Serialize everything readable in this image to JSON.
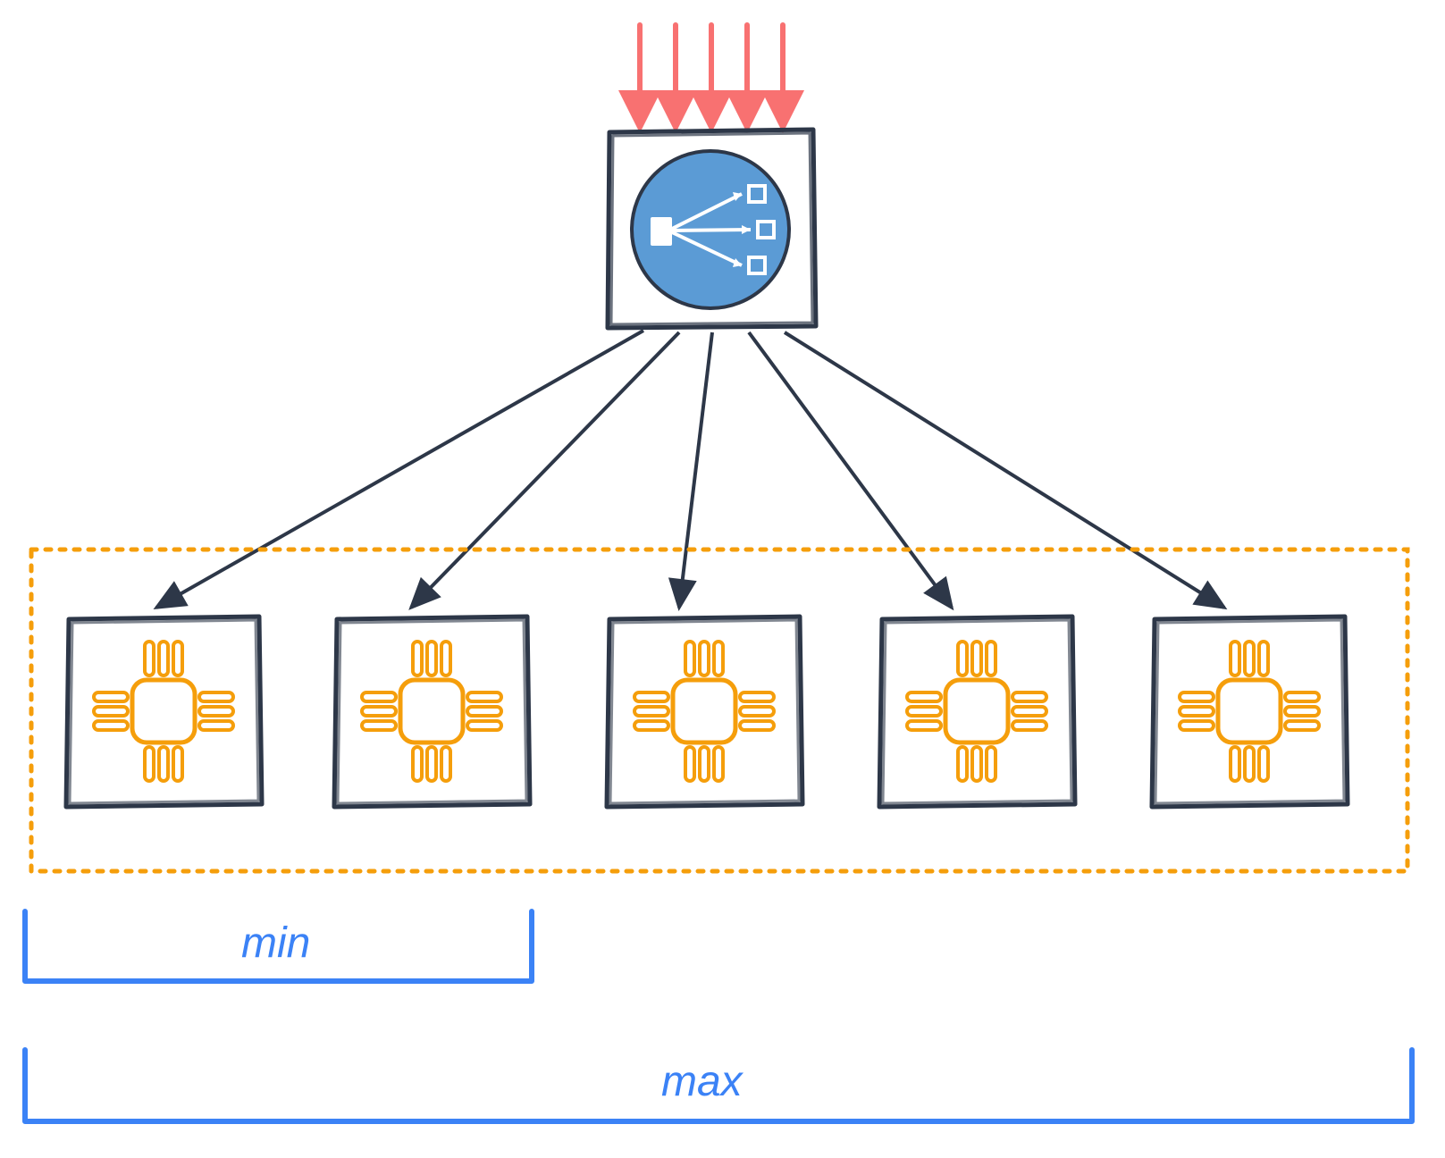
{
  "diagram": {
    "type": "load-balancer-autoscaling",
    "incoming_requests": {
      "count": 5,
      "color": "#F87171"
    },
    "load_balancer": {
      "icon": "load-balancer",
      "color": "#5B9BD5"
    },
    "instances": {
      "count": 5,
      "icon": "compute-chip",
      "color": "#F59E0B"
    },
    "autoscaling_group": {
      "border_color": "#F59E0B",
      "border_style": "dotted"
    },
    "capacity_labels": {
      "min": "min",
      "max": "max",
      "color": "#3B82F6"
    }
  },
  "colors": {
    "stroke_dark": "#2D3748",
    "red": "#F87171",
    "blue_fill": "#5B9BD5",
    "orange": "#F59E0B",
    "blue_bracket": "#3B82F6"
  }
}
